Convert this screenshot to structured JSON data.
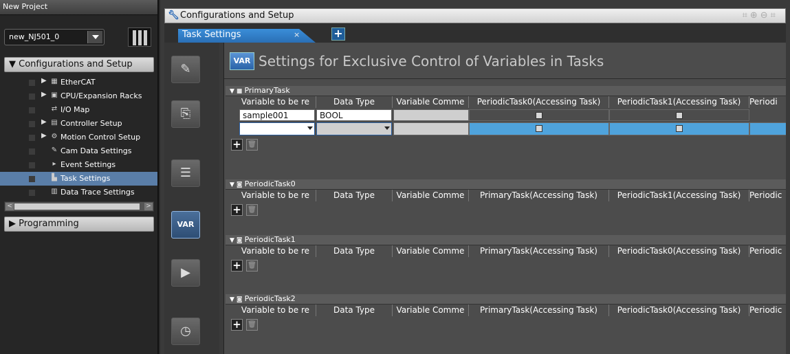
{
  "project": {
    "title": "New Project",
    "controller": "new_NJ501_0"
  },
  "left_pane": {
    "config_category": "▼ Configurations and Setup",
    "programming_category": "▶ Programming",
    "tree": [
      {
        "label": "EtherCAT",
        "expand": "▶",
        "icon": "ethercat-icon",
        "glyph": "▦"
      },
      {
        "label": "CPU/Expansion Racks",
        "expand": "▶",
        "icon": "rack-icon",
        "glyph": "▣"
      },
      {
        "label": "I/O Map",
        "expand": "",
        "icon": "io-map-icon",
        "glyph": "⇄"
      },
      {
        "label": "Controller Setup",
        "expand": "▶",
        "icon": "controller-icon",
        "glyph": "▤"
      },
      {
        "label": "Motion Control Setup",
        "expand": "▶",
        "icon": "motion-icon",
        "glyph": "⚙"
      },
      {
        "label": "Cam Data Settings",
        "expand": "",
        "icon": "cam-icon",
        "glyph": "✎"
      },
      {
        "label": "Event Settings",
        "expand": "",
        "icon": "event-flag-icon",
        "glyph": "▸"
      },
      {
        "label": "Task Settings",
        "expand": "",
        "icon": "task-icon",
        "glyph": "▙"
      },
      {
        "label": "Data Trace Settings",
        "expand": "",
        "icon": "trace-icon",
        "glyph": "▥"
      }
    ]
  },
  "editor": {
    "title": "Configurations and Setup",
    "tab": "Task Settings",
    "tab_close": "×",
    "add_tab": "+",
    "heading_badge": "VAR",
    "heading": "Settings for Exclusive Control of Variables in Tasks",
    "side_buttons": [
      {
        "name": "pencil-icon",
        "glyph": "✎"
      },
      {
        "name": "program-assign-icon",
        "glyph": "⎘"
      },
      {
        "name": "list-icon",
        "glyph": "☰"
      },
      {
        "name": "var-icon",
        "glyph": "VAR"
      },
      {
        "name": "task-run-icon",
        "glyph": "▶"
      },
      {
        "name": "task-timer-icon",
        "glyph": "◷"
      }
    ]
  },
  "sections": [
    {
      "name": "PrimaryTask",
      "headers": [
        "Variable to be re",
        "Data Type",
        "Variable Comme",
        "PeriodicTask0(Accessing Task)",
        "PeriodicTask1(Accessing Task)",
        "Periodi"
      ],
      "rows": [
        {
          "variable": "sample001",
          "type": "BOOL",
          "comment": ""
        }
      ]
    },
    {
      "name": "PeriodicTask0",
      "headers": [
        "Variable to be re",
        "Data Type",
        "Variable Comme",
        "PrimaryTask(Accessing Task)",
        "PeriodicTask1(Accessing Task)",
        "Periodic"
      ]
    },
    {
      "name": "PeriodicTask1",
      "headers": [
        "Variable to be re",
        "Data Type",
        "Variable Comme",
        "PrimaryTask(Accessing Task)",
        "PeriodicTask0(Accessing Task)",
        "Periodic"
      ]
    },
    {
      "name": "PeriodicTask2",
      "headers": [
        "Variable to be re",
        "Data Type",
        "Variable Comme",
        "PrimaryTask(Accessing Task)",
        "PeriodicTask0(Accessing Task)",
        "Periodic"
      ]
    }
  ],
  "colors": {
    "accent": "#4fa3dc",
    "tab": "#2a6fb5"
  }
}
